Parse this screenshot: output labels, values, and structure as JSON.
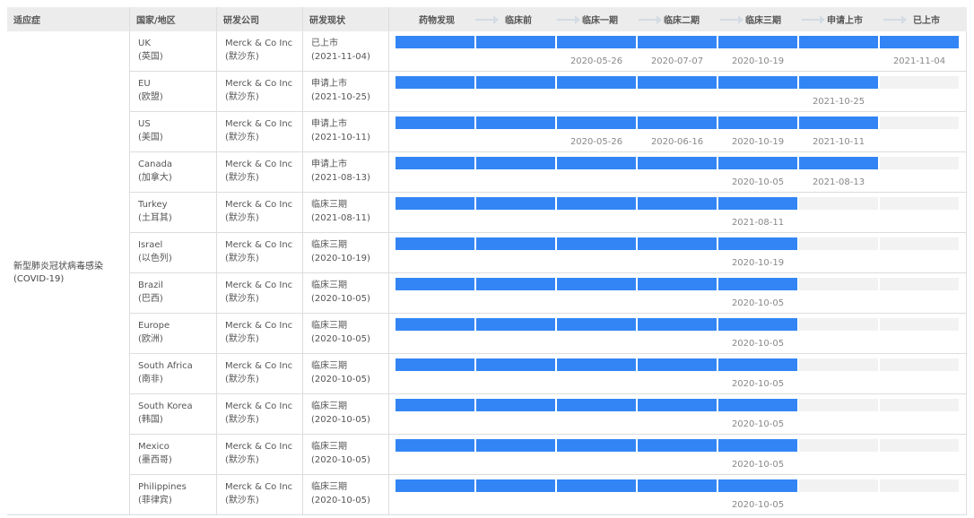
{
  "headers": {
    "indication": "适应症",
    "country": "国家/地区",
    "company": "研发公司",
    "status": "研发现状"
  },
  "stages": [
    "药物发现",
    "临床前",
    "临床一期",
    "临床二期",
    "临床三期",
    "申请上市",
    "已上市"
  ],
  "indication": "新型肺炎冠状病毒感染(COVID-19)",
  "colors": {
    "bar_filled": "#3385f5",
    "bar_empty": "#f2f2f2",
    "header_bg": "#ececec"
  },
  "rows": [
    {
      "country": "UK",
      "country_cn": "(英国)",
      "company": "Merck & Co Inc",
      "company_cn": "(默沙东)",
      "status": "已上市",
      "status_date": "(2021-11-04)",
      "filled": 7,
      "dates": [
        "",
        "",
        "2020-05-26",
        "2020-07-07",
        "2020-10-19",
        "",
        "2021-11-04"
      ]
    },
    {
      "country": "EU",
      "country_cn": "(欧盟)",
      "company": "Merck & Co Inc",
      "company_cn": "(默沙东)",
      "status": "申请上市",
      "status_date": "(2021-10-25)",
      "filled": 6,
      "dates": [
        "",
        "",
        "",
        "",
        "",
        "2021-10-25",
        ""
      ]
    },
    {
      "country": "US",
      "country_cn": "(美国)",
      "company": "Merck & Co Inc",
      "company_cn": "(默沙东)",
      "status": "申请上市",
      "status_date": "(2021-10-11)",
      "filled": 6,
      "dates": [
        "",
        "",
        "2020-05-26",
        "2020-06-16",
        "2020-10-19",
        "2021-10-11",
        ""
      ]
    },
    {
      "country": "Canada",
      "country_cn": "(加拿大)",
      "company": "Merck & Co Inc",
      "company_cn": "(默沙东)",
      "status": "申请上市",
      "status_date": "(2021-08-13)",
      "filled": 6,
      "dates": [
        "",
        "",
        "",
        "",
        "2020-10-05",
        "2021-08-13",
        ""
      ]
    },
    {
      "country": "Turkey",
      "country_cn": "(土耳其)",
      "company": "Merck & Co Inc",
      "company_cn": "(默沙东)",
      "status": "临床三期",
      "status_date": "(2021-08-11)",
      "filled": 5,
      "dates": [
        "",
        "",
        "",
        "",
        "2021-08-11",
        "",
        ""
      ]
    },
    {
      "country": "Israel",
      "country_cn": "(以色列)",
      "company": "Merck & Co Inc",
      "company_cn": "(默沙东)",
      "status": "临床三期",
      "status_date": "(2020-10-19)",
      "filled": 5,
      "dates": [
        "",
        "",
        "",
        "",
        "2020-10-19",
        "",
        ""
      ]
    },
    {
      "country": "Brazil",
      "country_cn": "(巴西)",
      "company": "Merck & Co Inc",
      "company_cn": "(默沙东)",
      "status": "临床三期",
      "status_date": "(2020-10-05)",
      "filled": 5,
      "dates": [
        "",
        "",
        "",
        "",
        "2020-10-05",
        "",
        ""
      ]
    },
    {
      "country": "Europe",
      "country_cn": "(欧洲)",
      "company": "Merck & Co Inc",
      "company_cn": "(默沙东)",
      "status": "临床三期",
      "status_date": "(2020-10-05)",
      "filled": 5,
      "dates": [
        "",
        "",
        "",
        "",
        "2020-10-05",
        "",
        ""
      ]
    },
    {
      "country": "South Africa",
      "country_cn": "(南非)",
      "company": "Merck & Co Inc",
      "company_cn": "(默沙东)",
      "status": "临床三期",
      "status_date": "(2020-10-05)",
      "filled": 5,
      "dates": [
        "",
        "",
        "",
        "",
        "2020-10-05",
        "",
        ""
      ]
    },
    {
      "country": "South Korea",
      "country_cn": "(韩国)",
      "company": "Merck & Co Inc",
      "company_cn": "(默沙东)",
      "status": "临床三期",
      "status_date": "(2020-10-05)",
      "filled": 5,
      "dates": [
        "",
        "",
        "",
        "",
        "2020-10-05",
        "",
        ""
      ]
    },
    {
      "country": "Mexico",
      "country_cn": "(墨西哥)",
      "company": "Merck & Co Inc",
      "company_cn": "(默沙东)",
      "status": "临床三期",
      "status_date": "(2020-10-05)",
      "filled": 5,
      "dates": [
        "",
        "",
        "",
        "",
        "2020-10-05",
        "",
        ""
      ]
    },
    {
      "country": "Philippines",
      "country_cn": "(菲律宾)",
      "company": "Merck & Co Inc",
      "company_cn": "(默沙东)",
      "status": "临床三期",
      "status_date": "(2020-10-05)",
      "filled": 5,
      "dates": [
        "",
        "",
        "",
        "",
        "2020-10-05",
        "",
        ""
      ]
    }
  ]
}
